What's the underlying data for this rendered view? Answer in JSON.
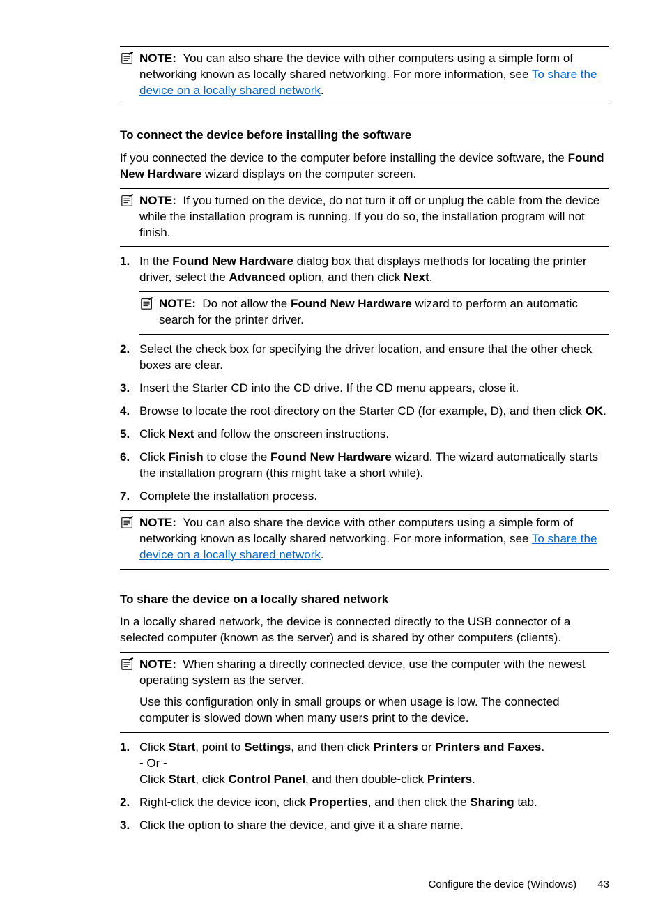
{
  "notes": {
    "n1": {
      "label": "NOTE:",
      "text_before_link": "You can also share the device with other computers using a simple form of networking known as locally shared networking. For more information, see ",
      "link": "To share the device on a locally shared network",
      "text_after_link": "."
    },
    "n2": {
      "label": "NOTE:",
      "text": "If you turned on the device, do not turn it off or unplug the cable from the device while the installation program is running. If you do so, the installation program will not finish."
    },
    "n3": {
      "label": "NOTE:",
      "pre": "Do not allow the ",
      "bold": "Found New Hardware",
      "post": " wizard to perform an automatic search for the printer driver."
    },
    "n4": {
      "label": "NOTE:",
      "text_before_link": "You can also share the device with other computers using a simple form of networking known as locally shared networking. For more information, see ",
      "link": "To share the device on a locally shared network",
      "text_after_link": "."
    },
    "n5": {
      "label": "NOTE:",
      "para1": "When sharing a directly connected device, use the computer with the newest operating system as the server.",
      "para2": "Use this configuration only in small groups or when usage is low. The connected computer is slowed down when many users print to the device."
    }
  },
  "sections": {
    "s1": {
      "heading": "To connect the device before installing the software",
      "intro_a": "If you connected the device to the computer before installing the device software, the ",
      "intro_b": "Found New Hardware",
      "intro_c": " wizard displays on the computer screen."
    },
    "s2": {
      "heading": "To share the device on a locally shared network",
      "intro": "In a locally shared network, the device is connected directly to the USB connector of a selected computer (known as the server) and is shared by other computers (clients)."
    }
  },
  "steps_a": {
    "1a": "In the ",
    "1b": "Found New Hardware",
    "1c": " dialog box that displays methods for locating the printer driver, select the ",
    "1d": "Advanced",
    "1e": " option, and then click ",
    "1f": "Next",
    "1g": ".",
    "2": "Select the check box for specifying the driver location, and ensure that the other check boxes are clear.",
    "3": "Insert the Starter CD into the CD drive. If the CD menu appears, close it.",
    "4a": "Browse to locate the root directory on the Starter CD (for example, D), and then click ",
    "4b": "OK",
    "4c": ".",
    "5a": "Click ",
    "5b": "Next",
    "5c": " and follow the onscreen instructions.",
    "6a": "Click ",
    "6b": "Finish",
    "6c": " to close the ",
    "6d": "Found New Hardware",
    "6e": " wizard. The wizard automatically starts the installation program (this might take a short while).",
    "7": "Complete the installation process."
  },
  "steps_b": {
    "1a": "Click ",
    "1b": "Start",
    "1c": ", point to ",
    "1d": "Settings",
    "1e": ", and then click ",
    "1f": "Printers",
    "1g": " or ",
    "1h": "Printers and Faxes",
    "1i": ".",
    "1or": "- Or -",
    "1j": "Click ",
    "1k": "Start",
    "1l": ", click ",
    "1m": "Control Panel",
    "1n": ", and then double-click ",
    "1o": "Printers",
    "1p": ".",
    "2a": "Right-click the device icon, click ",
    "2b": "Properties",
    "2c": ", and then click the ",
    "2d": "Sharing",
    "2e": " tab.",
    "3": "Click the option to share the device, and give it a share name."
  },
  "footer": {
    "section": "Configure the device (Windows)",
    "page": "43"
  }
}
